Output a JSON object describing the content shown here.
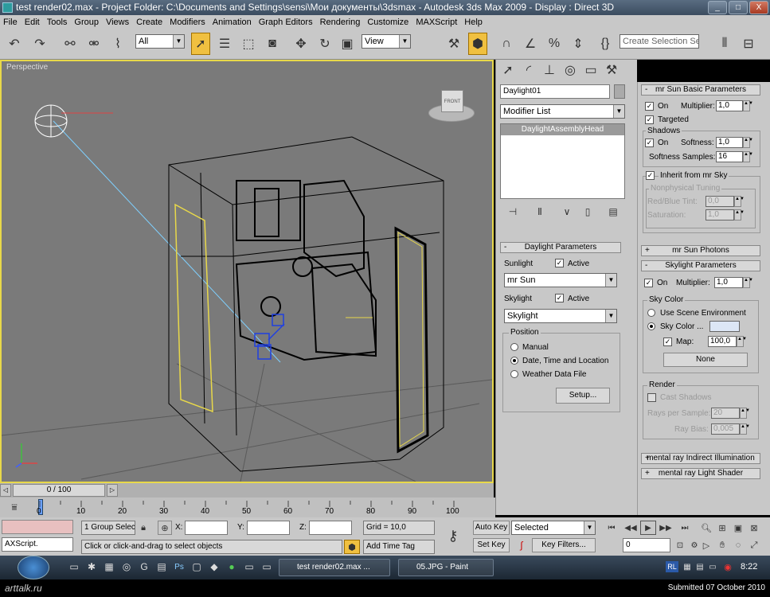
{
  "window": {
    "title": "test render02.max    - Project Folder: C:\\Documents and Settings\\sensi\\Мои документы\\3dsmax    - Autodesk 3ds Max  2009    - Display : Direct 3D",
    "min": "_",
    "max": "□",
    "close": "X"
  },
  "menu": [
    "File",
    "Edit",
    "Tools",
    "Group",
    "Views",
    "Create",
    "Modifiers",
    "Animation",
    "Graph Editors",
    "Rendering",
    "Customize",
    "MAXScript",
    "Help"
  ],
  "toolbar": {
    "filter": "All",
    "refcoord": "View",
    "selection_set_placeholder": "Create Selection Set"
  },
  "viewport": {
    "label": "Perspective",
    "cube_label": "FRONT"
  },
  "cmdpanel": {
    "object_name": "Daylight01",
    "modifier_list": "Modifier List",
    "stack_item": "DaylightAssemblyHead",
    "daylight_title": "Daylight Parameters",
    "sunlight": "Sunlight",
    "active1": "Active",
    "sun_value": "mr Sun",
    "skylight": "Skylight",
    "active2": "Active",
    "sky_value": "Skylight",
    "position": "Position",
    "manual": "Manual",
    "datetime": "Date, Time and Location",
    "weather": "Weather Data File",
    "setup": "Setup..."
  },
  "rollout": {
    "sun_title": "mr Sun Basic Parameters",
    "on": "On",
    "multiplier_lbl": "Multiplier:",
    "multiplier": "1,0",
    "targeted": "Targeted",
    "shadows": "Shadows",
    "on2": "On",
    "softness_lbl": "Softness:",
    "softness": "1,0",
    "softness_samples_lbl": "Softness Samples:",
    "softness_samples": "16",
    "inherit": "Inherit from mr Sky",
    "nonphys": "Nonphysical Tuning",
    "redblue_lbl": "Red/Blue Tint:",
    "redblue": "0,0",
    "saturation_lbl": "Saturation:",
    "saturation": "1,0",
    "photons_title": "mr Sun Photons",
    "sky_title": "Skylight Parameters",
    "sky_on": "On",
    "sky_mult_lbl": "Multiplier:",
    "sky_mult": "1,0",
    "sky_color": "Sky Color",
    "use_scene_env": "Use Scene Environment",
    "sky_color_opt": "Sky Color ...",
    "map": "Map:",
    "map_val": "100,0",
    "none": "None",
    "render": "Render",
    "cast_shadows": "Cast Shadows",
    "rays_lbl": "Rays per Sample:",
    "rays": "20",
    "raybias_lbl": "Ray Bias:",
    "raybias": "0,005",
    "indirect_title": "mental ray Indirect Illumination",
    "shader_title": "mental ray Light Shader"
  },
  "timeline": {
    "slider": "0 / 100",
    "ticks": [
      "0",
      "10",
      "20",
      "30",
      "40",
      "50",
      "60",
      "70",
      "80",
      "90",
      "100"
    ]
  },
  "status": {
    "maxscript": "AXScript.",
    "selected_count": "1 Group Selec",
    "x": "X:",
    "y": "Y:",
    "z": "Z:",
    "grid": "Grid = 10,0",
    "prompt": "Click or click-and-drag to select objects",
    "add_time_tag": "Add Time Tag",
    "auto_key": "Auto Key",
    "set_key": "Set Key",
    "selected": "Selected",
    "key_filters": "Key Filters...",
    "frame": "0"
  },
  "taskbar": {
    "task1": "test render02.max",
    "task1_more": "...",
    "task2": "05.JPG - Paint",
    "lang": "RL",
    "clock": "8:22"
  },
  "footer": {
    "brand": "arttalk.ru",
    "submitted": "Submitted 07 October 2010"
  },
  "colors": {
    "viewport_bg": "#7a7a7a",
    "active_border": "#e8d84a",
    "ui_gray": "#c8c8c8"
  }
}
